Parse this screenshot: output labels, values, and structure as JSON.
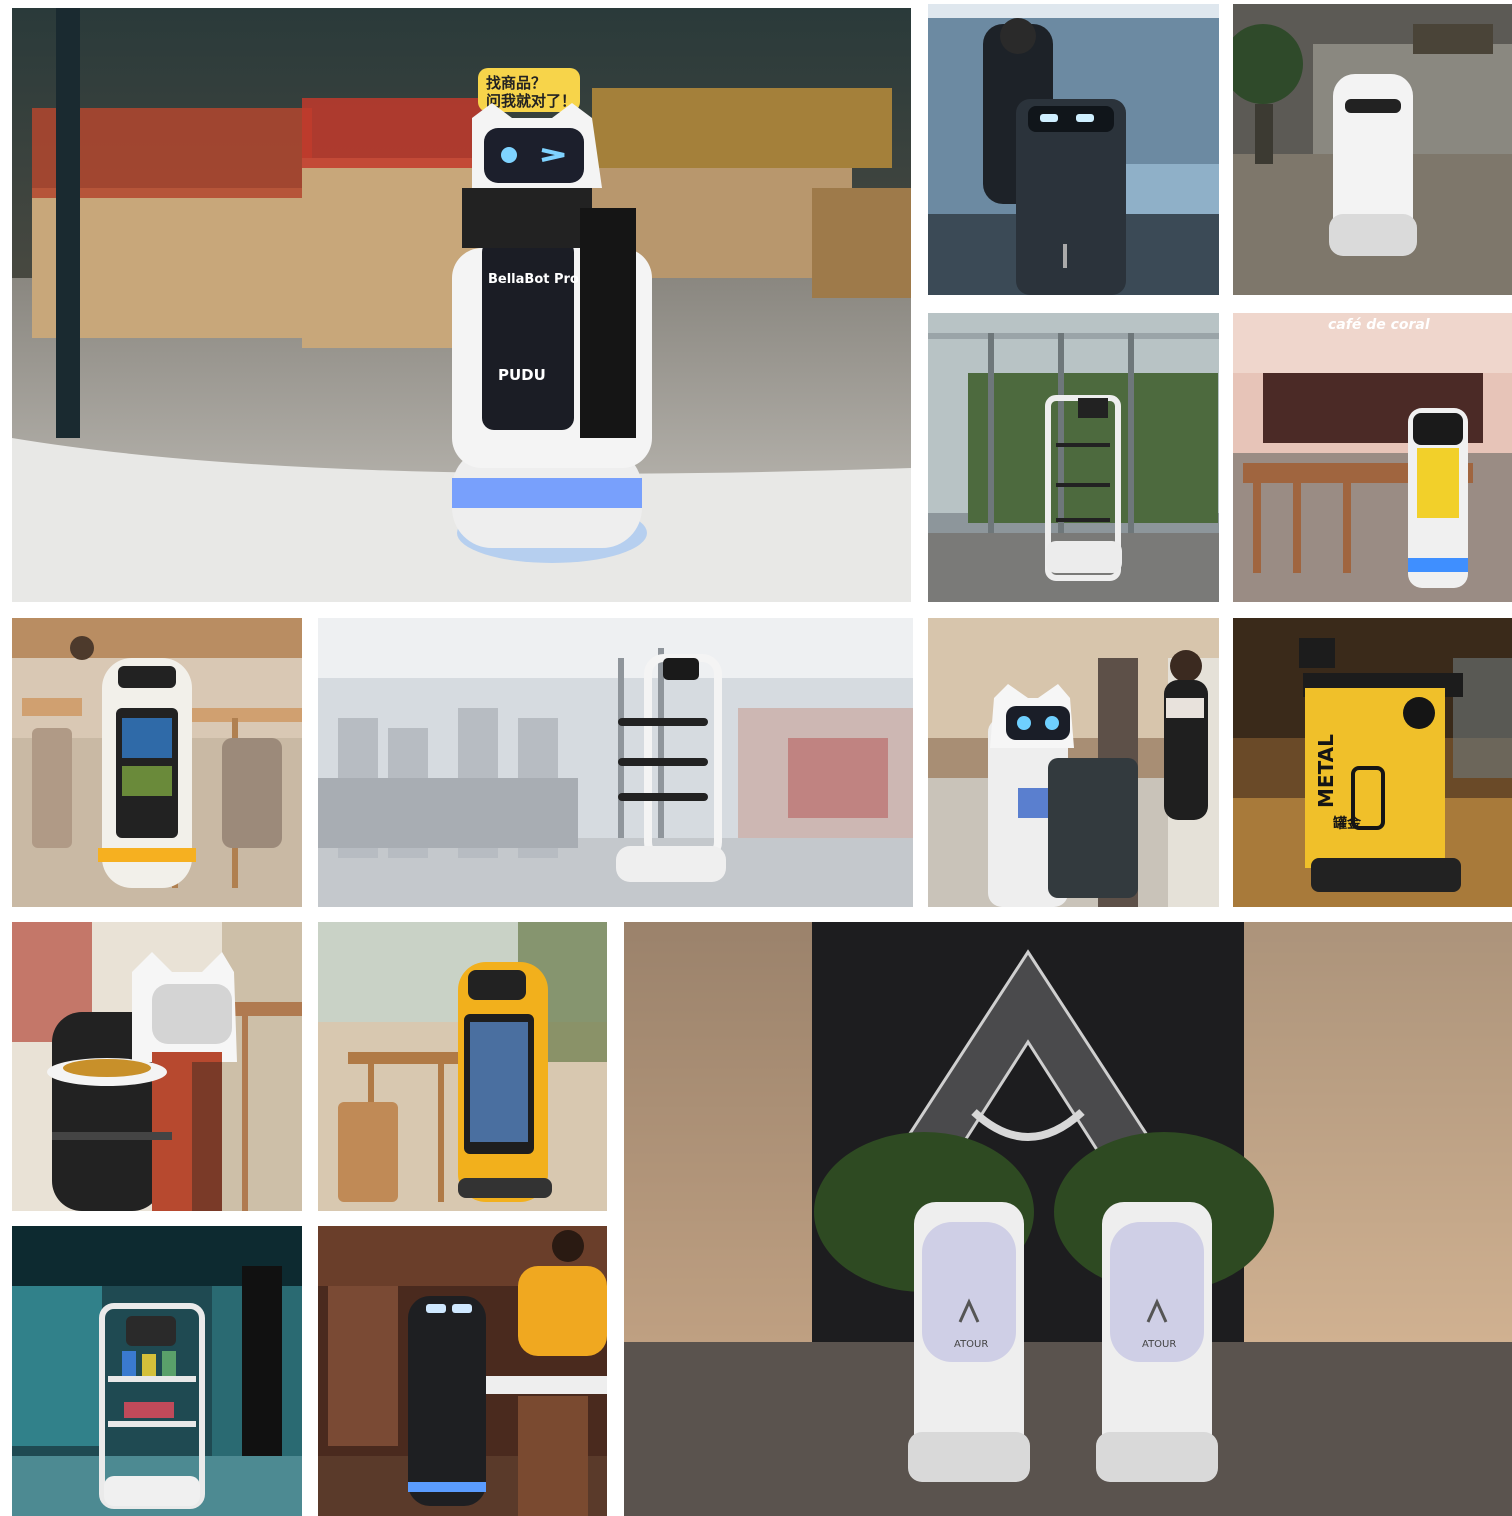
{
  "photo1": {
    "sign_line1": "找商品？",
    "sign_line2": "问我就对了！",
    "screen_title": "BellaBot Pro",
    "screen_brand": "PUDU"
  },
  "photo4": {
    "cafe_sign": "café de coral"
  },
  "photo9": {
    "bin_label_cn": "罐金",
    "bin_label_en": "METAL"
  },
  "photo14": {
    "robot_brand_left": "ATOUR",
    "robot_brand_right": "ATOUR"
  }
}
